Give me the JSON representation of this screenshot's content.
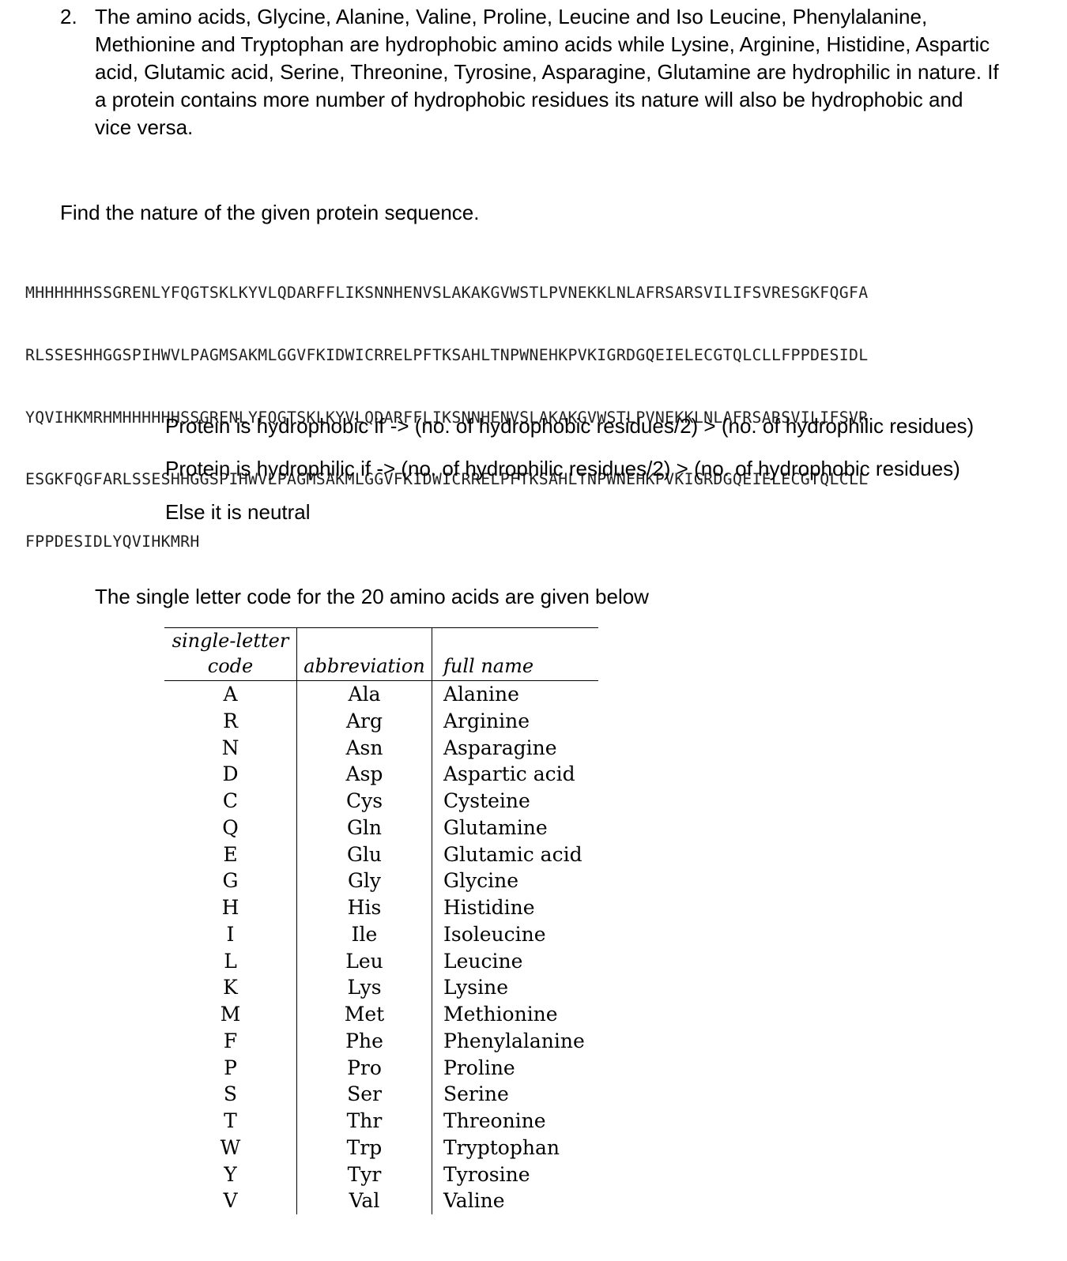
{
  "question": {
    "number": "2.",
    "lines": [
      "The amino acids, Glycine, Alanine, Valine, Proline, Leucine and Iso Leucine, Phenylalanine,",
      "Methionine and Tryptophan are hydrophobic amino acids while Lysine, Arginine, Histidine, Aspartic",
      "acid, Glutamic acid, Serine, Threonine, Tyrosine, Asparagine, Glutamine are hydrophilic in nature. If",
      "a protein contains more number of hydrophobic residues its nature will also be hydrophobic and",
      "vice versa."
    ]
  },
  "prompt": "Find the nature of the given protein sequence.",
  "sequence_lines": [
    "MHHHHHHSSGRENLYFQGTSKLKYVLQDARFFLIKSNNHENVSLAKAKGVWSTLPVNEKKLNLAFRSARSVILIFSVRESGKFQGFA",
    "RLSSESHHGGSPIHWVLPAGMSAKMLGGVFKIDWICRRELPFTKSAHLTNPWNEHKPVKIGRDGQEIELECGTQLCLLFPPDESIDL",
    "YQVIHKMRHMHHHHHHSSGRENLYFQGTSKLKYVLQDARFFLIKSNNHENVSLAKAKGVWSTLPVNEKKLNLAFRSARSVILIFSVR",
    "ESGKFQGFARLSSESHHGGSPIHWVLPAGMSAKMLGGVFKIDWICRRELPFTKSAHLTNPWNEHKPVKIGRDGQEIELECGTQLCLL",
    "FPPDESIDLYQVIHKMRH"
  ],
  "rules": [
    "Protein is hydrophobic if -> (no. of hydrophobic residues/2) > (no. of hydrophilic residues)",
    "Protein is hydrophilic if -> (no. of hydrophilic residues/2) > (no. of hydrophobic residues)",
    "Else it is neutral"
  ],
  "table_intro": "The single letter code for the 20 amino acids are given below",
  "table": {
    "headers": {
      "code_line1": "single-letter",
      "code_line2": "code",
      "abbreviation": "abbreviation",
      "full_name": "full name"
    },
    "rows": [
      {
        "code": "A",
        "abbr": "Ala",
        "name": "Alanine"
      },
      {
        "code": "R",
        "abbr": "Arg",
        "name": "Arginine"
      },
      {
        "code": "N",
        "abbr": "Asn",
        "name": "Asparagine"
      },
      {
        "code": "D",
        "abbr": "Asp",
        "name": "Aspartic acid"
      },
      {
        "code": "C",
        "abbr": "Cys",
        "name": "Cysteine"
      },
      {
        "code": "Q",
        "abbr": "Gln",
        "name": "Glutamine"
      },
      {
        "code": "E",
        "abbr": "Glu",
        "name": "Glutamic acid"
      },
      {
        "code": "G",
        "abbr": "Gly",
        "name": "Glycine"
      },
      {
        "code": "H",
        "abbr": "His",
        "name": "Histidine"
      },
      {
        "code": "I",
        "abbr": "Ile",
        "name": "Isoleucine"
      },
      {
        "code": "L",
        "abbr": "Leu",
        "name": "Leucine"
      },
      {
        "code": "K",
        "abbr": "Lys",
        "name": "Lysine"
      },
      {
        "code": "M",
        "abbr": "Met",
        "name": "Methionine"
      },
      {
        "code": "F",
        "abbr": "Phe",
        "name": "Phenylalanine"
      },
      {
        "code": "P",
        "abbr": "Pro",
        "name": "Proline"
      },
      {
        "code": "S",
        "abbr": "Ser",
        "name": "Serine"
      },
      {
        "code": "T",
        "abbr": "Thr",
        "name": "Threonine"
      },
      {
        "code": "W",
        "abbr": "Trp",
        "name": "Tryptophan"
      },
      {
        "code": "Y",
        "abbr": "Tyr",
        "name": "Tyrosine"
      },
      {
        "code": "V",
        "abbr": "Val",
        "name": "Valine"
      }
    ]
  }
}
